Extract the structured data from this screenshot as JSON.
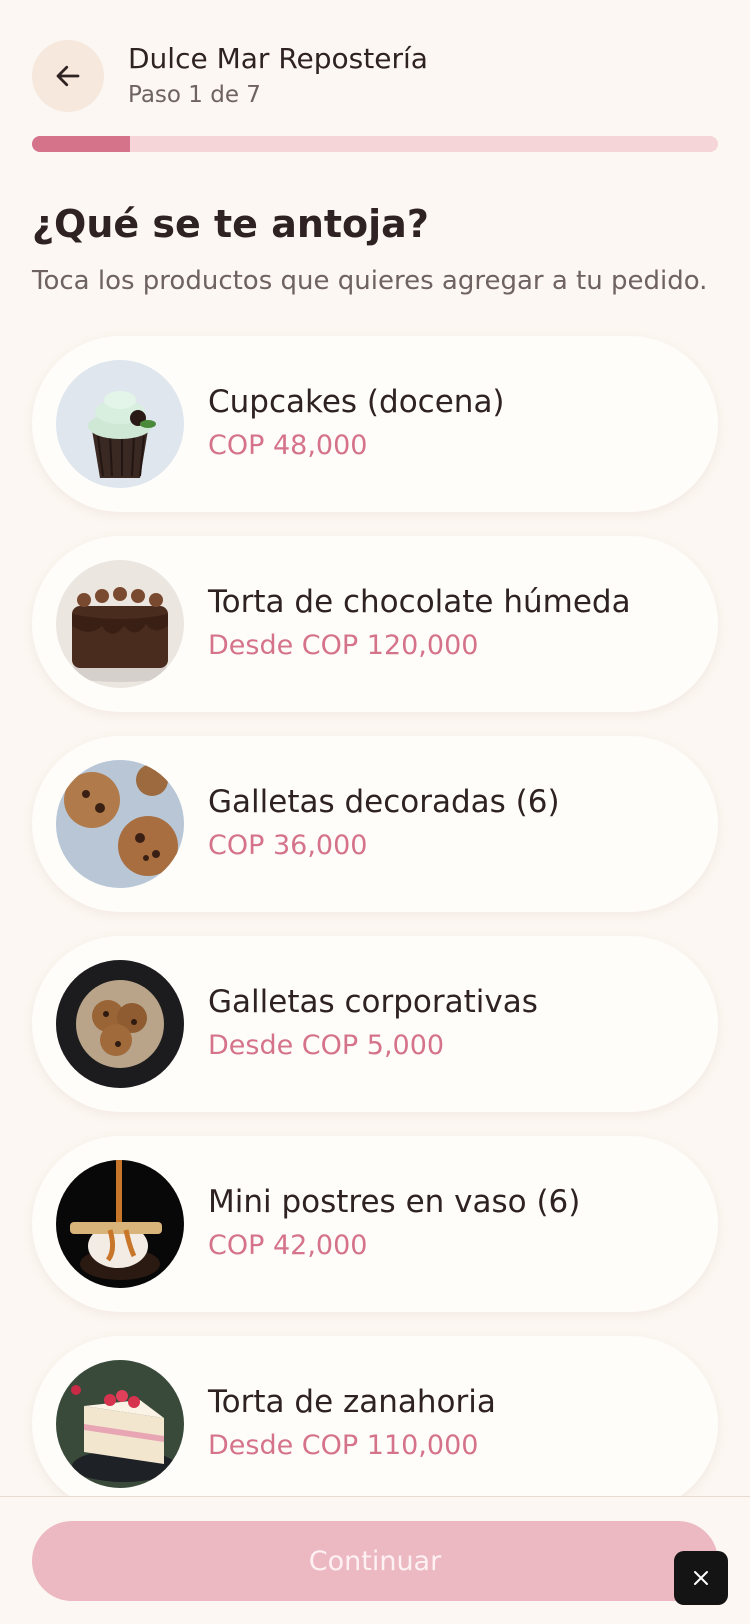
{
  "header": {
    "back_icon": "arrow-left-icon",
    "title": "Dulce Mar Repostería",
    "step": "Paso 1 de 7"
  },
  "progress": {
    "current_step": 1,
    "total_steps": 7
  },
  "page": {
    "heading": "¿Qué se te antoja?",
    "subheading": "Toca los productos que quieres agregar a tu pedido."
  },
  "products": [
    {
      "name": "Cupcakes (docena)",
      "price": "COP 48,000",
      "image": "cupcake-image"
    },
    {
      "name": "Torta de chocolate húmeda",
      "price": "Desde COP 120,000",
      "image": "chocolate-cake-image"
    },
    {
      "name": "Galletas decoradas (6)",
      "price": "COP 36,000",
      "image": "cookies-image"
    },
    {
      "name": "Galletas corporativas",
      "price": "Desde COP 5,000",
      "image": "cookie-basket-image"
    },
    {
      "name": "Mini postres en vaso (6)",
      "price": "COP 42,000",
      "image": "dessert-cup-image"
    },
    {
      "name": "Torta de zanahoria",
      "price": "Desde COP 110,000",
      "image": "carrot-cake-image"
    }
  ],
  "footer": {
    "continue_label": "Continuar",
    "close_icon": "close-icon"
  },
  "colors": {
    "background": "#fcf7f2",
    "accent": "#d4738a",
    "progress_track": "#f5d5d7",
    "button_disabled": "#ecb8c1"
  }
}
